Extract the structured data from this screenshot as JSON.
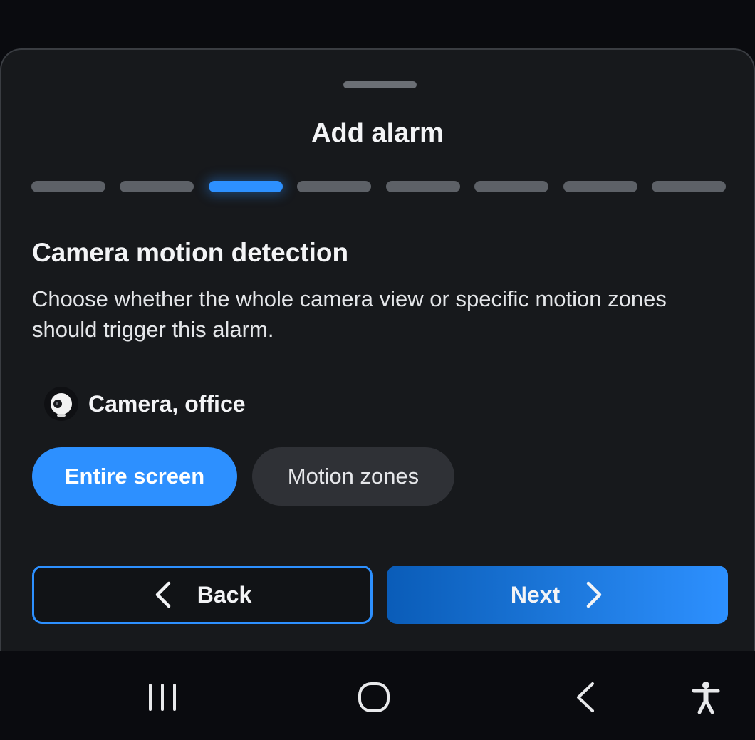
{
  "sheet": {
    "title": "Add alarm",
    "steps": {
      "total": 8,
      "current": 3
    },
    "heading": "Camera motion detection",
    "description": "Choose whether the whole camera view or specific motion zones should trigger this alarm.",
    "camera": {
      "label": "Camera, office",
      "icon": "camera-icon"
    },
    "options": [
      {
        "label": "Entire screen",
        "selected": true
      },
      {
        "label": "Motion zones",
        "selected": false
      }
    ],
    "buttons": {
      "back": {
        "label": "Back",
        "icon": "chevron-left-icon"
      },
      "next": {
        "label": "Next",
        "icon": "chevron-right-icon"
      }
    }
  },
  "nav": {
    "recents": "recents-icon",
    "home": "home-icon",
    "back": "back-icon",
    "accessibility": "accessibility-icon"
  },
  "colors": {
    "accent": "#2d90ff",
    "sheet_bg": "#17191c",
    "step_inactive": "#5d6167"
  }
}
